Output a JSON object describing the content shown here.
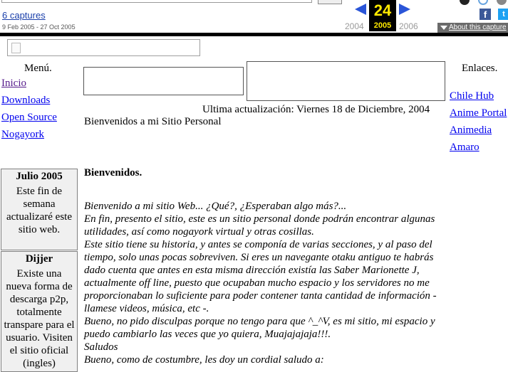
{
  "wayback": {
    "captures_label": "6 captures",
    "date_range": "9 Feb 2005 - 27 Oct 2005",
    "current_day": "24",
    "current_year": "2005",
    "prev_year": "2004",
    "next_year": "2006",
    "about_label": "About this capture",
    "facebook_glyph": "f",
    "twitter_glyph": "t",
    "accent_color": "#2a55d8",
    "highlight_color": "#ffea00"
  },
  "menu": {
    "title": "Menú.",
    "items": [
      {
        "label": "Inicio"
      },
      {
        "label": "Downloads"
      },
      {
        "label": "Open Source"
      },
      {
        "label": "Nogayork"
      }
    ]
  },
  "header": {
    "last_updated": "Ultima actualización: Viernes 18 de Diciembre, 2004",
    "welcome": "Bienvenidos a mi Sitio Personal"
  },
  "links": {
    "title": "Enlaces.",
    "items": [
      {
        "label": "Chile Hub"
      },
      {
        "label": "Anime Portal"
      },
      {
        "label": "Animedia"
      },
      {
        "label": "Amaro"
      }
    ]
  },
  "sidebar": {
    "boxes": [
      {
        "title": "Julio 2005",
        "body": "Este fin de semana actualizaré este sitio web."
      },
      {
        "title": "Dijjer",
        "body": "Existe una nueva forma de descarga p2p, totalmente transpare para el usuario. Visiten el sitio oficial (ingles)"
      }
    ]
  },
  "content": {
    "title": "Bienvenidos.",
    "paragraphs": [
      "Bienvenido a mi sitio Web... ¿Qué?, ¿Esperaban algo más?...",
      "En fin, presento el sitio, este es un sitio personal donde podrán encontrar algunas utilidades, así como nogayork virtual y otras cosillas.",
      "Este sitio tiene su historia, y antes se componía de varias secciones, y al paso del tiempo, solo unas pocas sobreviven. Si eres un navegante otaku antiguo te habrás dado cuenta que antes en esta misma dirección existía las Saber Marionette J, actualmente off line, puesto que ocupaban mucho espacio y los servidores no me proporcionaban lo suficiente para poder contener tanta cantidad de información - llamese videos, música, etc -.",
      "Bueno, no pido disculpas porque no tengo para que ^_^V, es mi sitio, mi espacio y puedo cambiarlo las veces que yo quiera, Muajajajaja!!!.",
      "Saludos",
      "Bueno, como de costumbre, les doy un cordial saludo a:"
    ]
  }
}
